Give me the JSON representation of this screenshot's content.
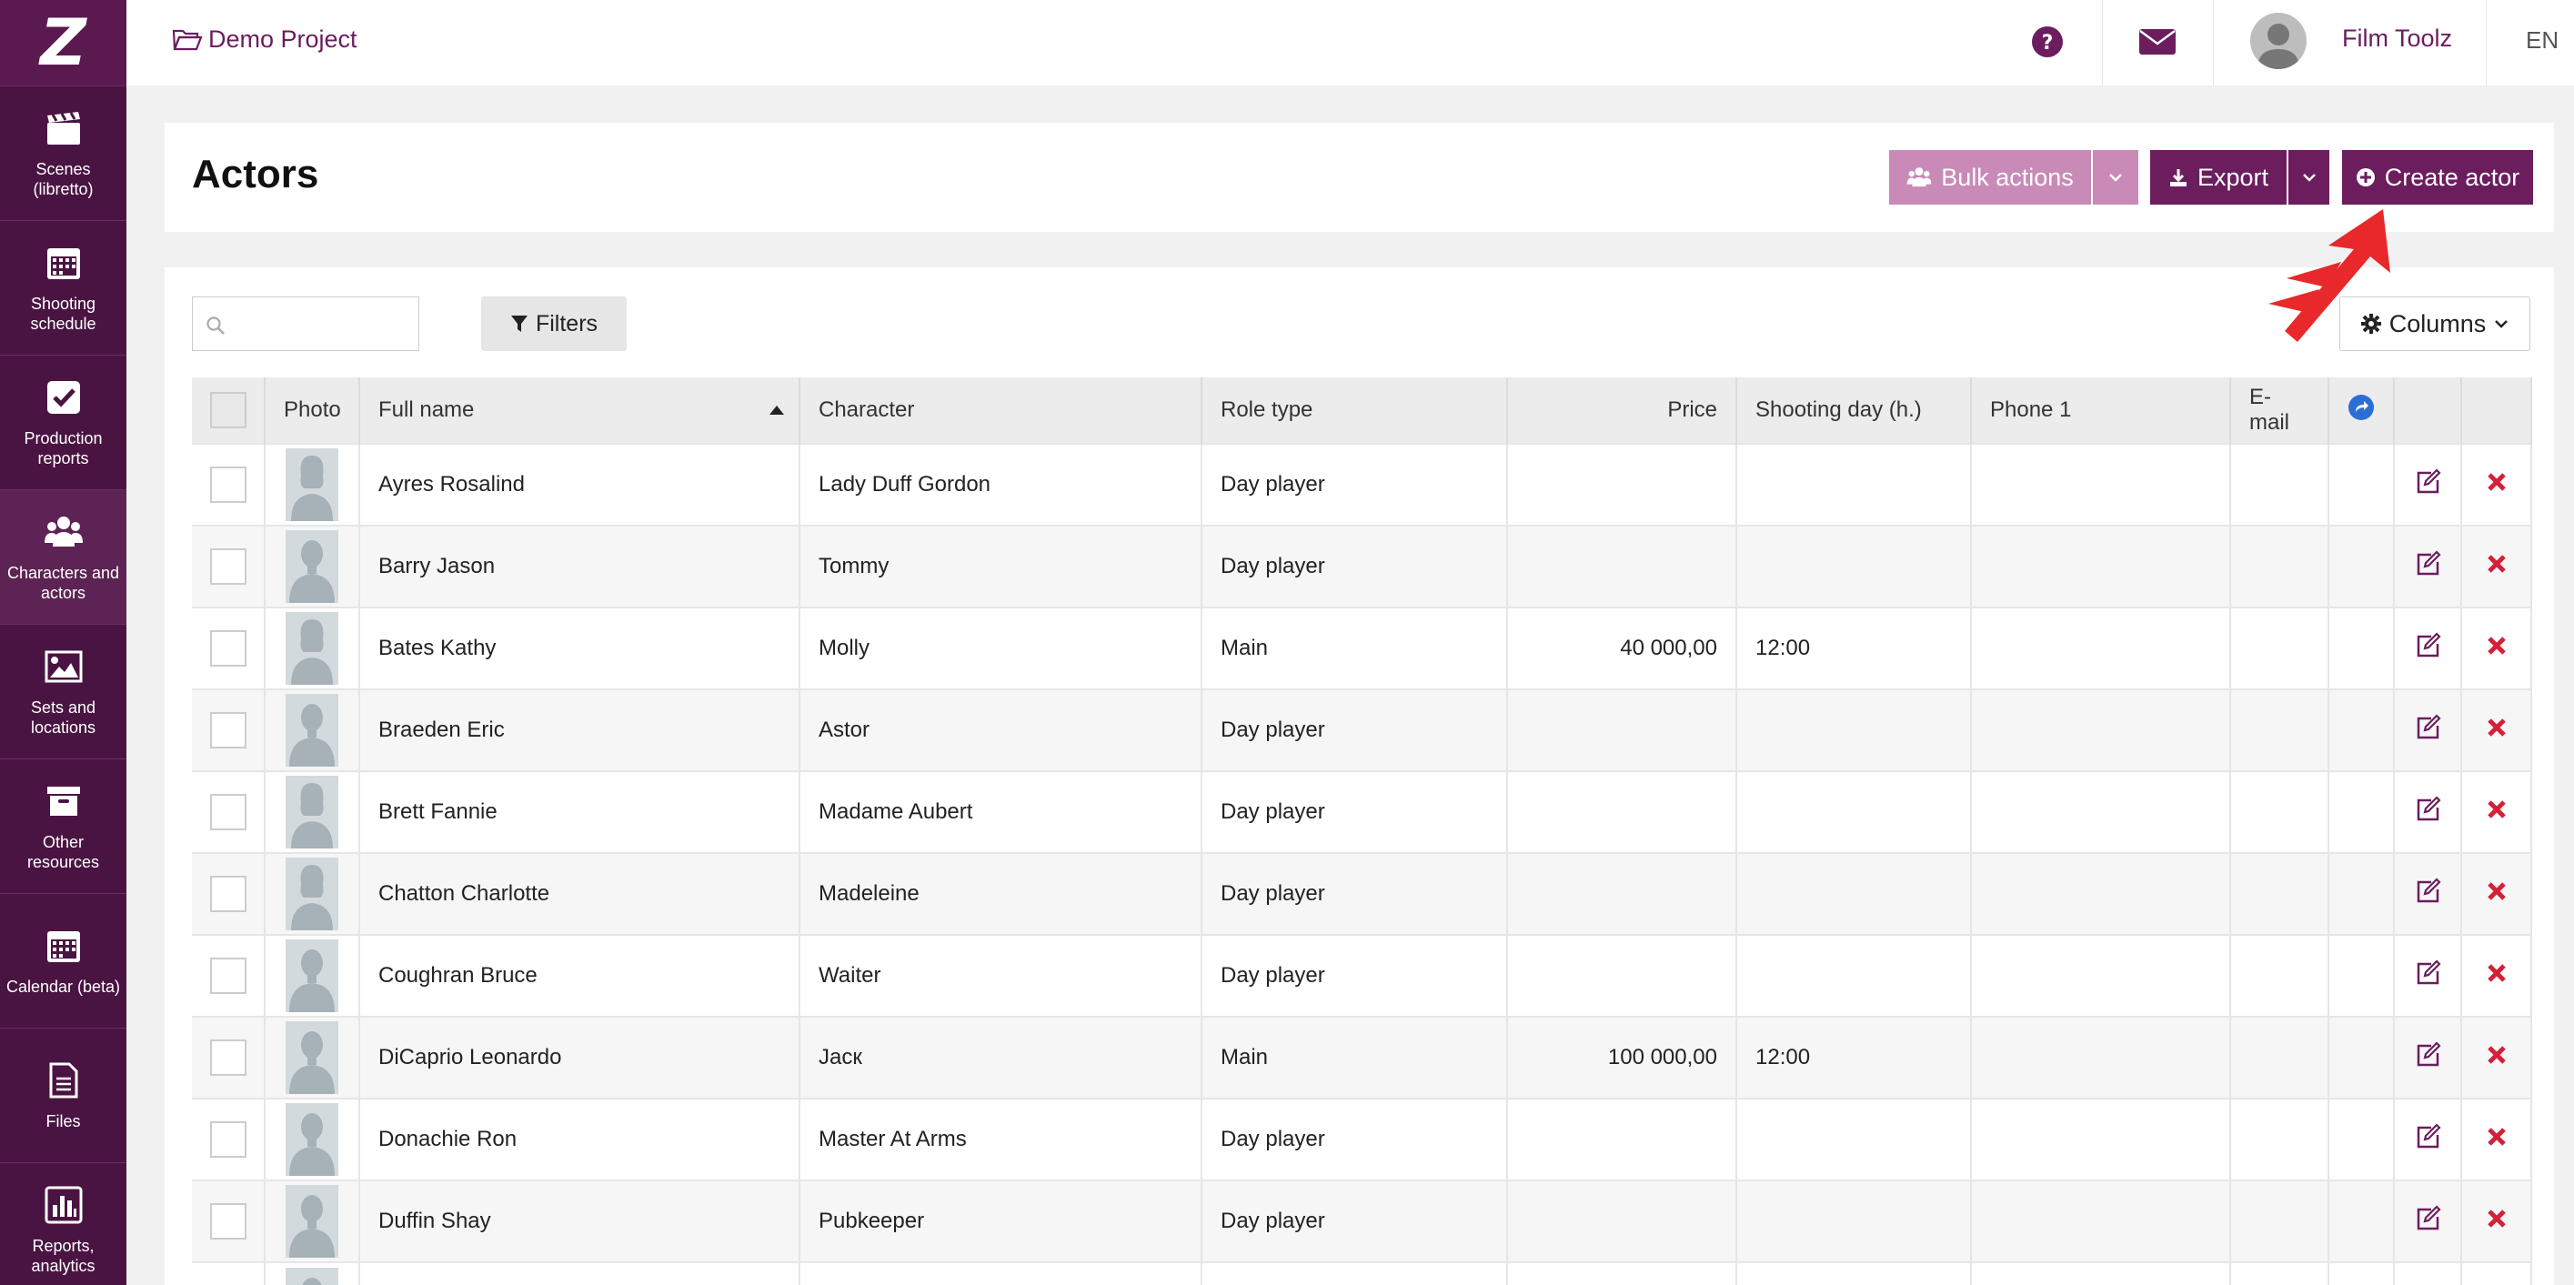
{
  "app": {
    "logo_text": "Z",
    "colors": {
      "brand": "#6b1d5e",
      "sidebar": "#4a1442",
      "bulk": "#c98ab8",
      "delete": "#d4203a",
      "sort_blue": "#2b6fd6",
      "annotation": "#e8282a"
    }
  },
  "sidebar": {
    "items": [
      {
        "icon": "clapperboard-icon",
        "label": "Scenes (libretto)"
      },
      {
        "icon": "calendar-grid-icon",
        "label": "Shooting schedule"
      },
      {
        "icon": "checkbox-icon",
        "label": "Production reports"
      },
      {
        "icon": "users-icon",
        "label": "Characters and actors"
      },
      {
        "icon": "image-icon",
        "label": "Sets and locations"
      },
      {
        "icon": "archive-box-icon",
        "label": "Other resources"
      },
      {
        "icon": "calendar-icon",
        "label": "Calendar (beta)"
      },
      {
        "icon": "file-icon",
        "label": "Files"
      },
      {
        "icon": "bar-chart-icon",
        "label": "Reports, analytics"
      }
    ]
  },
  "topbar": {
    "project_name": "Demo Project",
    "user_name": "Film Toolz",
    "language": "EN"
  },
  "page": {
    "title": "Actors",
    "bulk_actions_label": "Bulk actions",
    "export_label": "Export",
    "create_label": "Create actor",
    "filters_label": "Filters",
    "columns_label": "Columns",
    "search_placeholder": ""
  },
  "table": {
    "headers": {
      "photo": "Photo",
      "full_name": "Full name",
      "character": "Character",
      "role_type": "Role type",
      "price": "Price",
      "shooting_day": "Shooting day (h.)",
      "phone": "Phone 1",
      "email": "E-mail"
    },
    "rows": [
      {
        "name": "Ayres Rosalind",
        "character": "Lady Duff Gordon",
        "role": "Day player",
        "price": "",
        "shooting_day": "",
        "phone": "",
        "email": ""
      },
      {
        "name": "Barry Jason",
        "character": "Tommy",
        "role": "Day player",
        "price": "",
        "shooting_day": "",
        "phone": "",
        "email": ""
      },
      {
        "name": "Bates Kathy",
        "character": "Molly",
        "role": "Main",
        "price": "40 000,00",
        "shooting_day": "12:00",
        "phone": "",
        "email": ""
      },
      {
        "name": "Braeden Eric",
        "character": "Astor",
        "role": "Day player",
        "price": "",
        "shooting_day": "",
        "phone": "",
        "email": ""
      },
      {
        "name": "Brett Fannie",
        "character": "Madame Aubert",
        "role": "Day player",
        "price": "",
        "shooting_day": "",
        "phone": "",
        "email": ""
      },
      {
        "name": "Chatton Charlotte",
        "character": "Madeleine",
        "role": "Day player",
        "price": "",
        "shooting_day": "",
        "phone": "",
        "email": ""
      },
      {
        "name": "Coughran Bruce",
        "character": "Waiter",
        "role": "Day player",
        "price": "",
        "shooting_day": "",
        "phone": "",
        "email": ""
      },
      {
        "name": "DiCaprio Leonardo",
        "character": "Jacк",
        "role": "Main",
        "price": "100 000,00",
        "shooting_day": "12:00",
        "phone": "",
        "email": ""
      },
      {
        "name": "Donachie Ron",
        "character": "Master At Arms",
        "role": "Day player",
        "price": "",
        "shooting_day": "",
        "phone": "",
        "email": ""
      },
      {
        "name": "Duffin Shay",
        "character": "Pubkeeper",
        "role": "Day player",
        "price": "",
        "shooting_day": "",
        "phone": "",
        "email": ""
      },
      {
        "name": "",
        "character": "",
        "role": "",
        "price": "",
        "shooting_day": "",
        "phone": "",
        "email": ""
      }
    ]
  }
}
